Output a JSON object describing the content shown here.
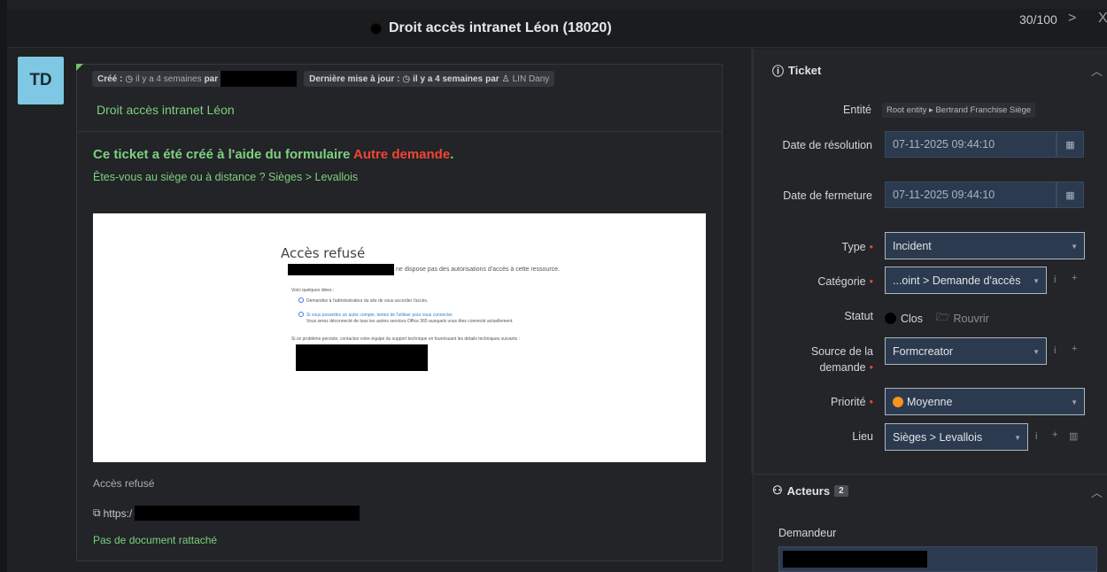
{
  "header": {
    "title": "Droit accès intranet Léon (18020)",
    "counter": "30/100",
    "next": ">",
    "close": "X"
  },
  "timeline": {
    "avatar_initials": "TD",
    "created_label": "Créé :",
    "created_time": "il y a 4 semaines",
    "by": "par",
    "updated_label": "Dernière mise à jour :",
    "updated_time": "il y a 4 semaines",
    "updated_by": "LIN Dany",
    "ticket_name": "Droit accès intranet Léon",
    "form_text": "Ce ticket a été créé à l'aide du formulaire",
    "form_name": "Autre demande",
    "form_end": ".",
    "question": "Êtes-vous au siège ou à distance ?  Sièges > Levallois",
    "screenshot": {
      "title": "Accès refusé",
      "line1": "ne dispose pas des autorisations d'accès à cette ressource.",
      "ideas": "Voici quelques idées :",
      "opt1": "Demandez à l'administrateur du site de vous accorder l'accès.",
      "opt2": "Si vous possédez un autre compte, tentez de l'utiliser pour vous connecter.",
      "opt2b": "Vous serez déconnecté de tous les autres services Office 365 auxquels vous êtes connecté actuellement.",
      "footer": "Si ce problème persiste, contactez votre équipe du support technique en fournissant les détails techniques suivants :"
    },
    "caption": "Accès refusé",
    "link": "https:/",
    "no_doc": "Pas de document rattaché"
  },
  "panel": {
    "ticket_section": "Ticket",
    "fields": {
      "entite_label": "Entité",
      "entite_value": "Root entity ▸ Bertrand Franchise Siège",
      "resolution_label": "Date de résolution",
      "resolution_value": "07-11-2025 09:44:10",
      "fermeture_label": "Date de fermeture",
      "fermeture_value": "07-11-2025 09:44:10",
      "type_label": "Type",
      "type_value": "Incident",
      "categorie_label": "Catégorie",
      "categorie_value": "...oint > Demande d'accès",
      "statut_label": "Statut",
      "statut_value": "Clos",
      "reopen": "Rouvrir",
      "source_label": "Source de la demande",
      "source_value": "Formcreator",
      "priorite_label": "Priorité",
      "priorite_value": "Moyenne",
      "lieu_label": "Lieu",
      "lieu_value": "Sièges > Levallois"
    },
    "actors_section": "Acteurs",
    "actors_count": "2",
    "demandeur_label": "Demandeur"
  },
  "colors": {
    "green": "#7ed07e",
    "red": "#f44336",
    "orange": "#f7931e",
    "input_bg": "#2b3a4e"
  }
}
